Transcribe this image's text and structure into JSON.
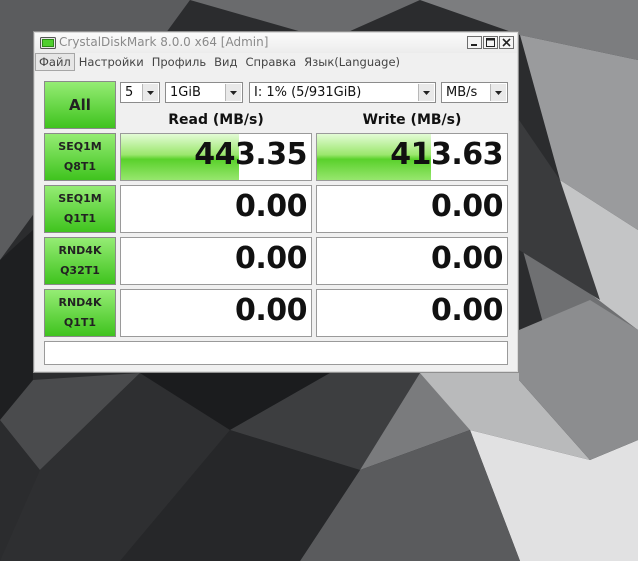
{
  "window": {
    "title": "CrystalDiskMark 8.0.0 x64 [Admin]"
  },
  "menu": [
    {
      "label": "Файл",
      "active": true
    },
    {
      "label": "Настройки"
    },
    {
      "label": "Профиль"
    },
    {
      "label": "Вид"
    },
    {
      "label": "Справка"
    },
    {
      "label": "Язык(Language)"
    }
  ],
  "controls": {
    "all_label": "All",
    "count": "5",
    "size": "1GiB",
    "drive": "I: 1% (5/931GiB)",
    "unit": "MB/s"
  },
  "headers": {
    "read": "Read (MB/s)",
    "write": "Write (MB/s)"
  },
  "tests": [
    {
      "line1": "SEQ1M",
      "line2": "Q8T1",
      "read": "443.35",
      "write": "413.63",
      "read_fill": 0.62,
      "write_fill": 0.6
    },
    {
      "line1": "SEQ1M",
      "line2": "Q1T1",
      "read": "0.00",
      "write": "0.00",
      "read_fill": 0,
      "write_fill": 0
    },
    {
      "line1": "RND4K",
      "line2": "Q32T1",
      "read": "0.00",
      "write": "0.00",
      "read_fill": 0,
      "write_fill": 0
    },
    {
      "line1": "RND4K",
      "line2": "Q1T1",
      "read": "0.00",
      "write": "0.00",
      "read_fill": 0,
      "write_fill": 0
    }
  ],
  "status_text": "",
  "colors": {
    "button_green": "#3fc31e",
    "bar_green": "#5ad12b"
  }
}
